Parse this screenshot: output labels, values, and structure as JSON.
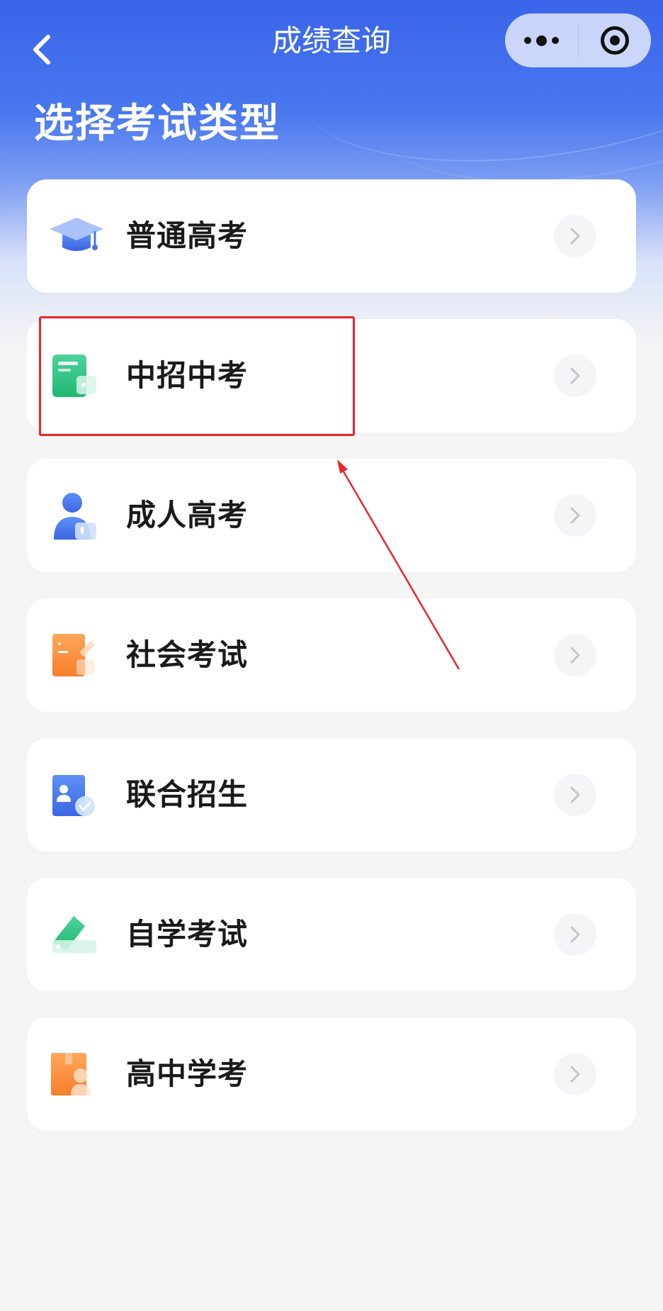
{
  "nav": {
    "title": "成绩查询",
    "back_icon": "chevron-left-icon",
    "menu_icon": "more-dots-icon",
    "close_icon": "target-circle-icon"
  },
  "page": {
    "heading": "选择考试类型"
  },
  "exam_types": [
    {
      "label": "普通高考",
      "icon": "graduation-cap-icon"
    },
    {
      "label": "中招中考",
      "icon": "green-certificate-icon"
    },
    {
      "label": "成人高考",
      "icon": "person-icon"
    },
    {
      "label": "社会考试",
      "icon": "orange-document-icon"
    },
    {
      "label": "联合招生",
      "icon": "user-badge-icon"
    },
    {
      "label": "自学考试",
      "icon": "green-tag-icon"
    },
    {
      "label": "高中学考",
      "icon": "orange-folder-icon"
    }
  ],
  "annotation": {
    "box_color": "#e8272b",
    "arrow_color": "#e8272b"
  },
  "colors": {
    "header_blue": "#3a64ea",
    "background": "#f5f5f5",
    "card": "#ffffff",
    "text": "#1a1a1a"
  }
}
